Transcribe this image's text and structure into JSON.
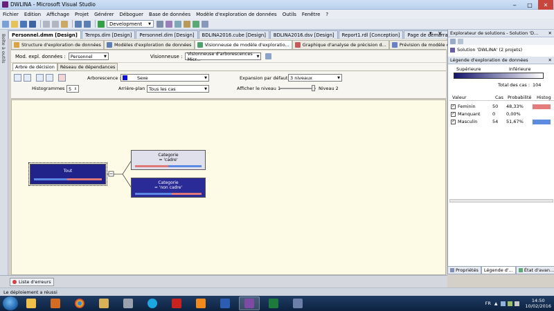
{
  "window": {
    "title": "DWLINA - Microsoft Visual Studio",
    "min": "‒",
    "max": "□",
    "close": "✕"
  },
  "menu": [
    "Fichier",
    "Edition",
    "Affichage",
    "Projet",
    "Générer",
    "Déboguer",
    "Base de données",
    "Modèle d'exploration de données",
    "Outils",
    "Fenêtre",
    "?"
  ],
  "toolbar": {
    "configuration": "Development"
  },
  "leftbar": {
    "label": "Boîte à outils"
  },
  "doc_tabs": [
    "Personnel.dmm [Design]",
    "Temps.dim [Design]",
    "Personnel.dim [Design]",
    "BDLINA2016.cube [Design]",
    "BDLINA2016.dsv [Design]",
    "Report1.rdl [Conception]",
    "Page de démarrage"
  ],
  "designer_tabs": [
    "Structure d'exploration de données",
    "Modèles d'exploration de données",
    "Visionneuse de modèle d'exploratio...",
    "Graphique d'analyse de précision d...",
    "Prévision de modèle d'exploration d..."
  ],
  "model_row": {
    "model_label": "Mod. expl. données :",
    "model_value": "Personnel",
    "viewer_label": "Visionneuse :",
    "viewer_value": "Visionneuse d'arborescences Micr..."
  },
  "inner_tabs": [
    "Arbre de décision",
    "Réseau de dépendances"
  ],
  "options": {
    "tree_label": "Arborescence :",
    "tree_value": "Sexe",
    "expansion_label": "Expansion par défaut :",
    "expansion_value": "3 niveaux",
    "hist_label": "Histogrammes :",
    "hist_value": "5",
    "bg_label": "Arrière-plan :",
    "bg_value": "Tous les cas",
    "level_label": "Afficher le niveau 1",
    "level_end": "Niveau 2"
  },
  "tree": {
    "root": {
      "label": "Tout",
      "fractions": [
        0.51,
        0.49
      ]
    },
    "nodes": [
      {
        "line1": "Categorie",
        "line2": "= 'cadre'",
        "fractions": [
          0.5,
          0.5
        ]
      },
      {
        "line1": "Categorie",
        "line2": "= 'non cadre'",
        "fractions": [
          0.45,
          0.55
        ]
      }
    ],
    "colors": {
      "female": "#e07878",
      "male": "#5b89e3"
    }
  },
  "solution_explorer": {
    "title": "Explorateur de solutions - Solution 'D...",
    "item": "Solution 'DWLINA' (2 projets)"
  },
  "legend": {
    "title": "Légende d'exploration de données",
    "higher": "Supérieure",
    "lower": "Inférieure",
    "total_label": "Total des cas :",
    "total_value": "104",
    "columns": [
      "Valeur",
      "Cas",
      "Probabilité",
      "Histog"
    ],
    "rows": [
      {
        "value": "Feminin",
        "cases": "50",
        "prob": "48,33%",
        "color": "#e57c7c"
      },
      {
        "value": "Manquant",
        "cases": "0",
        "prob": "0,00%",
        "color": "#ffffff"
      },
      {
        "value": "Masculin",
        "cases": "54",
        "prob": "51,67%",
        "color": "#5c8be0"
      }
    ]
  },
  "right_bottom_tabs": [
    "Propriétés",
    "Légende d'...",
    "État d'avan..."
  ],
  "error_tab": "Liste d'erreurs",
  "status": "Le déploiement a réussi",
  "tray": {
    "lang": "FR",
    "time": "14:50",
    "date": "10/02/2016"
  }
}
